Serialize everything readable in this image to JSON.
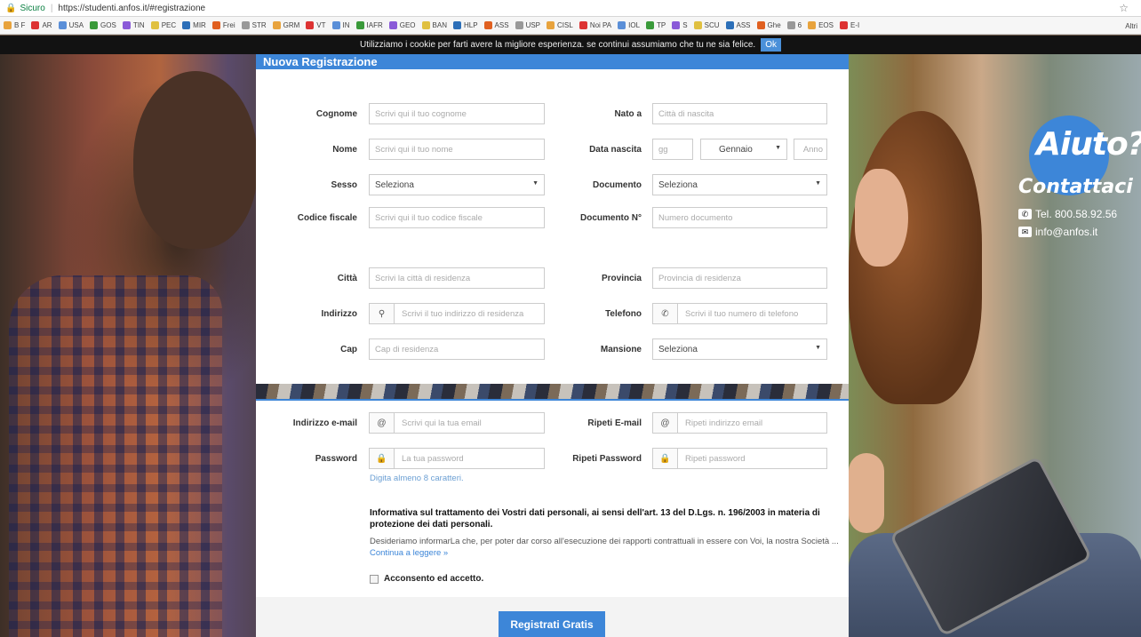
{
  "browser": {
    "secure_label": "Sicuro",
    "url": "https://studenti.anfos.it/#registrazione",
    "bookmarks": [
      "B F",
      "AR",
      "USA",
      "GOS",
      "TIN",
      "PEC",
      "MIR",
      "Frei",
      "STR",
      "GRM",
      "VT",
      "IN",
      "IAFR",
      "GEO",
      "BAN",
      "HLP",
      "ASS",
      "USP",
      "CISL",
      "Noi PA",
      "IOL",
      "TP",
      "S",
      "SCU",
      "ASS",
      "Ghe",
      "6",
      "EOS",
      "E-I"
    ],
    "bookmarks_more": "Altri"
  },
  "cookie": {
    "text": "Utilizziamo i cookie per farti avere la migliore esperienza. se continui assumiamo che tu ne sia felice.",
    "ok": "Ok"
  },
  "form": {
    "title": "Nuova Registrazione",
    "cognome": {
      "label": "Cognome",
      "placeholder": "Scrivi qui il tuo cognome"
    },
    "nato_a": {
      "label": "Nato a",
      "placeholder": "Città di nascita"
    },
    "nome": {
      "label": "Nome",
      "placeholder": "Scrivi qui il tuo nome"
    },
    "data_nascita": {
      "label": "Data nascita",
      "giorno_placeholder": "gg",
      "mese": "Gennaio",
      "anno_placeholder": "Anno"
    },
    "sesso": {
      "label": "Sesso",
      "value": "Seleziona"
    },
    "documento": {
      "label": "Documento",
      "value": "Seleziona"
    },
    "codice_fiscale": {
      "label": "Codice fiscale",
      "placeholder": "Scrivi qui il tuo codice fiscale"
    },
    "documento_n": {
      "label": "Documento N°",
      "placeholder": "Numero documento"
    },
    "citta": {
      "label": "Città",
      "placeholder": "Scrivi la città di residenza"
    },
    "provincia": {
      "label": "Provincia",
      "placeholder": "Provincia di residenza"
    },
    "indirizzo": {
      "label": "Indirizzo",
      "placeholder": "Scrivi il tuo indirizzo di residenza"
    },
    "telefono": {
      "label": "Telefono",
      "placeholder": "Scrivi il tuo numero di telefono"
    },
    "cap": {
      "label": "Cap",
      "placeholder": "Cap di residenza"
    },
    "mansione": {
      "label": "Mansione",
      "value": "Seleziona"
    },
    "email": {
      "label": "Indirizzo e-mail",
      "placeholder": "Scrivi qui la tua email"
    },
    "ripeti_email": {
      "label": "Ripeti E-mail",
      "placeholder": "Ripeti indirizzo email"
    },
    "password": {
      "label": "Password",
      "placeholder": "La tua password",
      "hint": "Digita almeno 8 caratteri."
    },
    "ripeti_password": {
      "label": "Ripeti Password",
      "placeholder": "Ripeti password"
    },
    "privacy_title": "Informativa sul trattamento dei Vostri dati personali, ai sensi dell'art. 13 del D.Lgs. n. 196/2003 in materia di protezione dei dati personali.",
    "privacy_text": "Desideriamo informarLa che, per poter dar corso all'esecuzione dei rapporti contrattuali in essere con Voi, la nostra Società ...",
    "privacy_link": "Continua a leggere »",
    "consent": "Acconsento ed accetto.",
    "submit": "Registrati Gratis"
  },
  "help": {
    "title": "Aiuto?",
    "contact": "Contattaci",
    "phone": "Tel. 800.58.92.56",
    "email": "info@anfos.it"
  },
  "colors": {
    "accent": "#3d86d8",
    "cookie_bar": "#121212"
  }
}
